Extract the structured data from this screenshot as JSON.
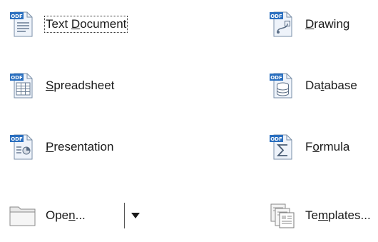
{
  "launcher": {
    "text_document": {
      "label_pre": "Text ",
      "label_key": "D",
      "label_post": "ocument",
      "badge": "ODF"
    },
    "spreadsheet": {
      "label_pre": "",
      "label_key": "S",
      "label_post": "preadsheet",
      "badge": "ODF"
    },
    "presentation": {
      "label_pre": "",
      "label_key": "P",
      "label_post": "resentation",
      "badge": "ODF"
    },
    "open": {
      "label_pre": "Ope",
      "label_key": "n",
      "label_post": "..."
    },
    "drawing": {
      "label_pre": "",
      "label_key": "D",
      "label_post": "rawing",
      "badge": "ODF"
    },
    "database": {
      "label_pre": "Da",
      "label_key": "t",
      "label_post": "abase",
      "badge": "ODF"
    },
    "formula": {
      "label_pre": "F",
      "label_key": "o",
      "label_post": "rmula",
      "badge": "ODF"
    },
    "templates": {
      "label_pre": "Te",
      "label_key": "m",
      "label_post": "plates..."
    }
  },
  "colors": {
    "badge_blue": "#2a6fbf",
    "page_fill": "#eef3fa",
    "page_stroke": "#7a8fa8",
    "folder_fill": "#e8e8e8",
    "folder_stroke": "#8a8a8a"
  }
}
